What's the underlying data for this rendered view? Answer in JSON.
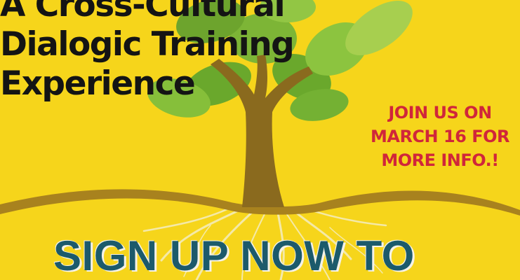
{
  "poster": {
    "headline": [
      "A Cross-Cultural",
      "Dialogic Training",
      "Experience"
    ],
    "callout": [
      "JOIN US ON",
      "MARCH 16 FOR",
      "MORE INFO.!"
    ],
    "cta": "SIGN UP NOW TO"
  },
  "colors": {
    "background": "#f6d51b",
    "headline_text": "#141414",
    "callout_text": "#d0263a",
    "cta_text": "#1c5a6b",
    "trunk": "#8a6a1e",
    "leaf_green": "#78b432",
    "leaf_light": "#a7cf4f",
    "roots": "#f2e9b0"
  },
  "icons": {
    "illustration": "tree-with-roots"
  }
}
